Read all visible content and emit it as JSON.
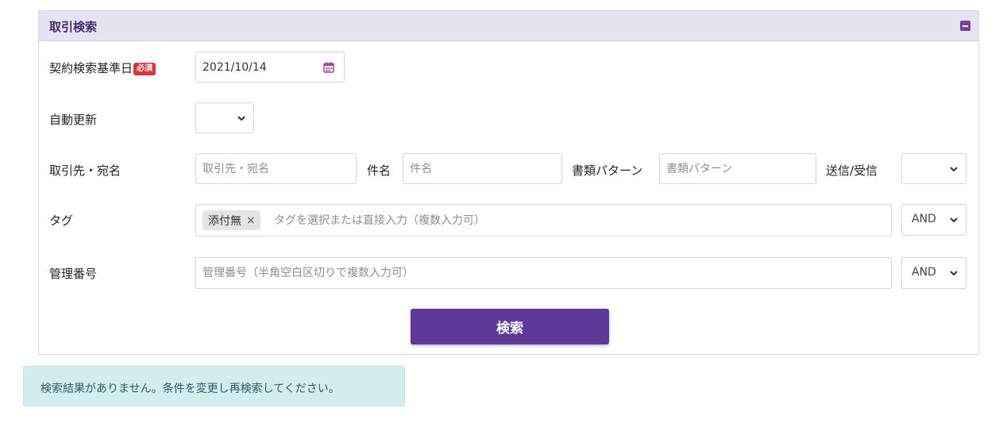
{
  "panel": {
    "title": "取引検索"
  },
  "form": {
    "contract_date": {
      "label": "契約検索基準日",
      "required_badge": "必須",
      "value": "2021/10/14",
      "icon": "calendar-icon"
    },
    "auto_renew": {
      "label": "自動更新",
      "value": ""
    },
    "counterparty": {
      "label": "取引先・宛名",
      "placeholder": "取引先・宛名"
    },
    "subject": {
      "label": "件名",
      "placeholder": "件名"
    },
    "doc_pattern": {
      "label": "書類パターン",
      "placeholder": "書類パターン"
    },
    "send_receive": {
      "label": "送信/受信",
      "value": ""
    },
    "tags": {
      "label": "タグ",
      "chips": [
        {
          "text": "添付無",
          "remove": "×"
        }
      ],
      "placeholder": "タグを選択または直接入力（複数入力可）",
      "operator": "AND"
    },
    "management_no": {
      "label": "管理番号",
      "placeholder": "管理番号（半角空白区切りで複数入力可）",
      "operator": "AND"
    },
    "search_button": "検索"
  },
  "alert": {
    "message": "検索結果がありません。条件を変更し再検索してください。"
  },
  "colors": {
    "accent": "#5e3a98",
    "header_bg": "#e5e3ef",
    "required": "#d9353e",
    "alert_bg": "#d3edee"
  }
}
